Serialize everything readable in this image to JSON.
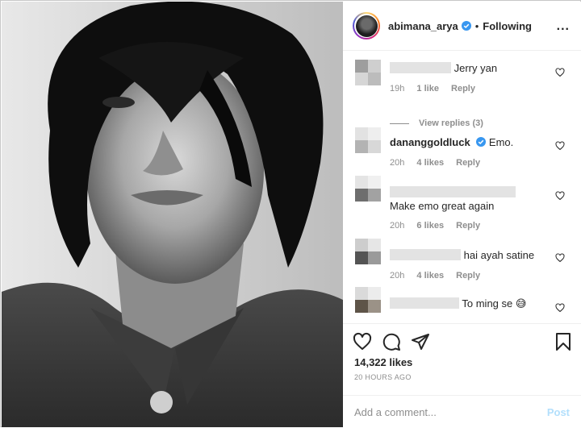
{
  "post": {
    "username": "abimana_arya",
    "separator": "•",
    "follow_status": "Following",
    "more_icon": "more-horizontal-icon"
  },
  "comments": [
    {
      "username": "",
      "text": "Jerry yan",
      "time": "19h",
      "likes": "1 like",
      "reply": "Reply"
    },
    {
      "username": "dananggoldluck",
      "text": "Emo.",
      "time": "20h",
      "likes": "4 likes",
      "reply": "Reply"
    },
    {
      "username": "",
      "text": "Make emo great again",
      "time": "20h",
      "likes": "6 likes",
      "reply": "Reply"
    },
    {
      "username": "",
      "text": "hai ayah satine",
      "time": "20h",
      "likes": "4 likes",
      "reply": "Reply"
    },
    {
      "username": "",
      "text": "To ming se 😅",
      "time": "",
      "likes": "",
      "reply": ""
    }
  ],
  "view_replies": "View replies (3)",
  "stats": {
    "likes": "14,322 likes",
    "time_ago": "20 HOURS AGO"
  },
  "composer": {
    "placeholder": "Add a comment...",
    "post_label": "Post"
  },
  "colors": {
    "verified": "#3897f0",
    "post_disabled": "#b2dffc",
    "muted": "#8e8e8e"
  }
}
